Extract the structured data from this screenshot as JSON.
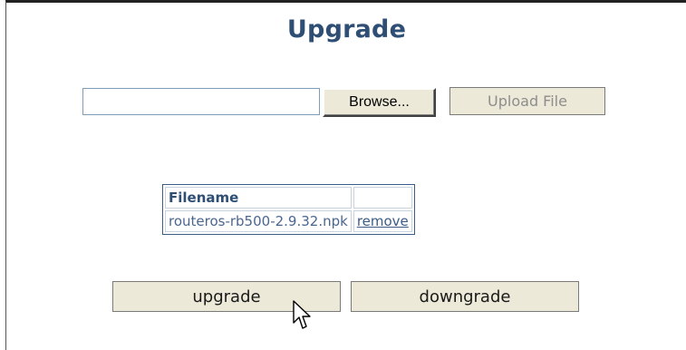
{
  "page": {
    "title": "Upgrade"
  },
  "upload": {
    "file_value": "",
    "browse_label": "Browse...",
    "upload_label": "Upload File"
  },
  "files_table": {
    "columns": [
      "Filename",
      ""
    ],
    "rows": [
      {
        "filename": "routeros-rb500-2.9.32.npk",
        "action": "remove"
      }
    ]
  },
  "actions": {
    "upgrade_label": "upgrade",
    "downgrade_label": "downgrade"
  },
  "icons": {
    "cursor": "mouse-pointer-icon"
  },
  "colors": {
    "title": "#2f4e74",
    "table_border": "#3a5c86",
    "button_face": "#ece9d8",
    "disabled_text": "#8d8d8d"
  }
}
